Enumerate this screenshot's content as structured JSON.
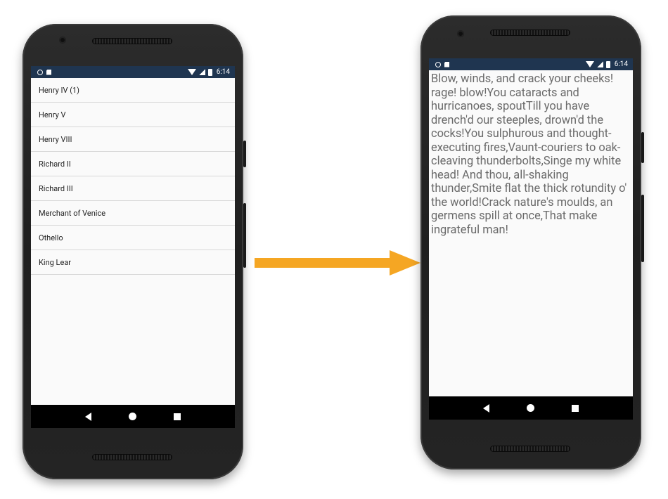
{
  "left_phone": {
    "status": {
      "time": "6:14"
    },
    "list_items": [
      "Henry IV (1)",
      "Henry V",
      "Henry VIII",
      "Richard II",
      "Richard III",
      "Merchant of Venice",
      "Othello",
      "King Lear"
    ]
  },
  "right_phone": {
    "status": {
      "time": "6:14"
    },
    "quote_text": "Blow, winds, and crack your cheeks! rage! blow!You cataracts and hurricanoes, spoutTill you have drench'd our steeples, drown'd the cocks!You sulphurous and thought-executing fires,Vaunt-couriers to oak-cleaving thunderbolts,Singe my white head! And thou, all-shaking thunder,Smite flat the thick rotundity o' the world!Crack nature's moulds, an germens spill at once,That make ingrateful man!"
  },
  "icons": {
    "status_left": [
      "circle-notification-icon",
      "sd-card-icon"
    ],
    "status_right": [
      "wifi-icon",
      "signal-icon",
      "battery-icon"
    ],
    "nav": [
      "back-icon",
      "home-icon",
      "recents-icon"
    ],
    "transition": "arrow-right-icon"
  },
  "colors": {
    "status_bar": "#1f3550",
    "screen_bg": "#fafafa",
    "nav_bar": "#000000",
    "arrow": "#f5a623",
    "quote_text": "#6a6a6a"
  }
}
